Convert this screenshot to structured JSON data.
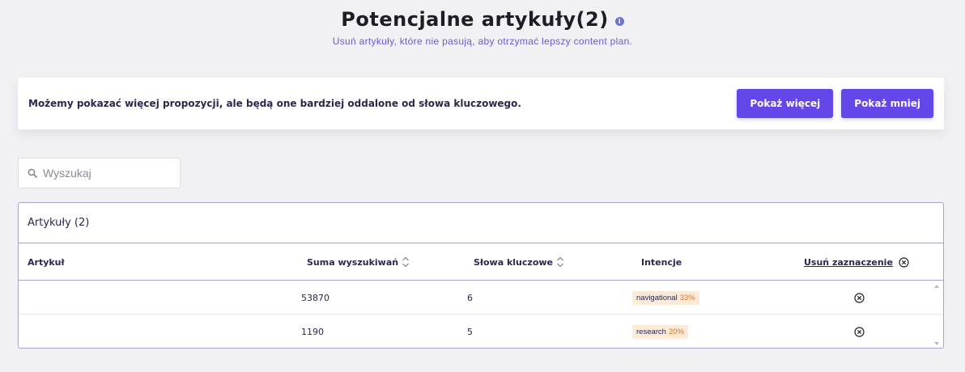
{
  "header": {
    "title": "Potencjalne artykuły(2)",
    "info_icon": "info-icon",
    "subtitle": "Usuń artykuły, które nie pasują, aby otrzymać lepszy content plan."
  },
  "banner": {
    "text": "Możemy pokazać więcej propozycji, ale będą one bardziej oddalone od słowa kluczowego.",
    "show_more_label": "Pokaż więcej",
    "show_less_label": "Pokaż mniej",
    "accent_color": "#6546e8"
  },
  "search": {
    "placeholder": "Wyszukaj",
    "value": "",
    "icon": "search-icon"
  },
  "table": {
    "title": "Artykuły (2)",
    "columns": {
      "article": "Artykuł",
      "search_sum": "Suma wyszukiwań",
      "keywords": "Słowa kluczowe",
      "intent": "Intencje",
      "clear_selection": "Usuń zaznaczenie"
    },
    "rows": [
      {
        "article": "",
        "search_sum": "53870",
        "keywords": "6",
        "intent": "navigational",
        "intent_pct": "33%"
      },
      {
        "article": "",
        "search_sum": "1190",
        "keywords": "5",
        "intent": "research",
        "intent_pct": "20%"
      }
    ]
  }
}
